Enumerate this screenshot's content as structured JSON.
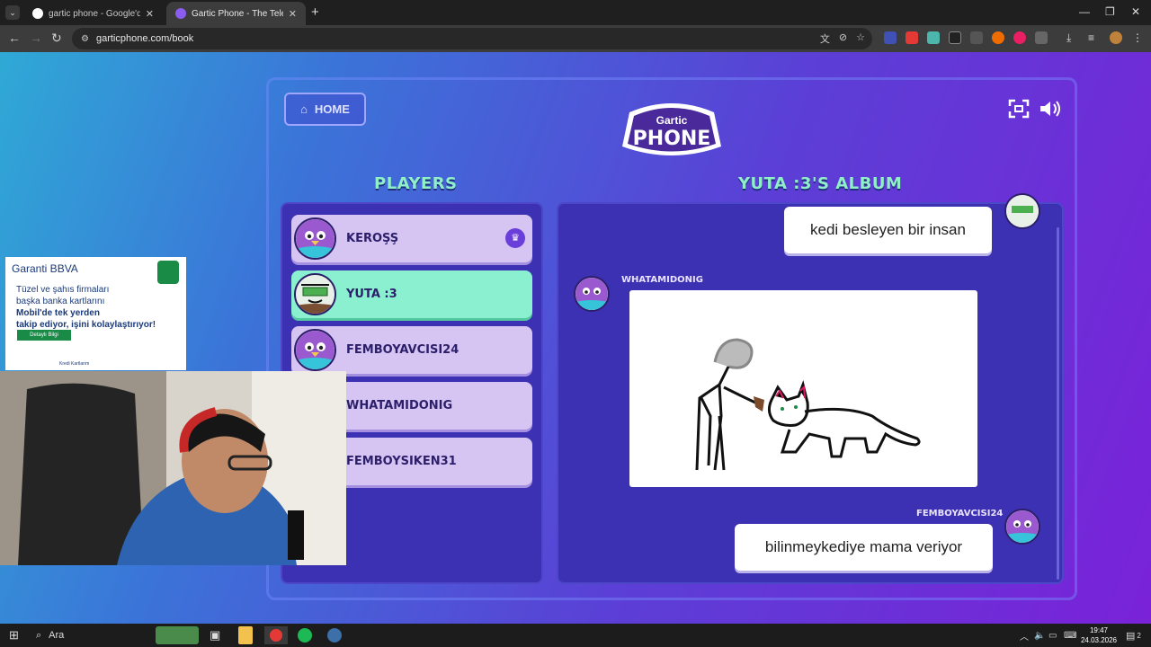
{
  "browser": {
    "tabs": [
      {
        "title": "gartic phone - Google'da Ara",
        "favicon_color": "#ffffff",
        "active": false
      },
      {
        "title": "Gartic Phone - The Telephone G",
        "favicon_color": "#8a5cf0",
        "active": true
      }
    ],
    "url": "garticphone.com/book"
  },
  "game": {
    "home_label": "HOME",
    "logo_top": "Gartic",
    "logo_bottom": "PHONE",
    "players_title": "PLAYERS",
    "album_title": "YUTA :3'S ALBUM",
    "players": [
      {
        "name": "KEROŞŞ",
        "host": true,
        "selected": false
      },
      {
        "name": "YUTA :3",
        "host": false,
        "selected": true
      },
      {
        "name": "FEMBOYAVCISI24",
        "host": false,
        "selected": false
      },
      {
        "name": "WHATAMIDONIG",
        "host": false,
        "selected": false
      },
      {
        "name": "FEMBOYSIKEN31",
        "host": false,
        "selected": false
      }
    ],
    "album": {
      "first_phrase": "kedi besleyen bir insan",
      "drawing_author": "WHATAMIDONIG",
      "guess_author": "FEMBOYAVCISI24",
      "guess_phrase": "bilinmeykediye mama veriyor"
    }
  },
  "ad": {
    "brand": "Garanti BBVA",
    "body_line1": "Tüzel ve şahıs firmaları",
    "body_line2": "başka banka kartlarını",
    "body_line3": "Mobil'de tek yerden",
    "body_line4": "takip ediyor, işini kolaylaştırıyor!",
    "cta": "Detaylı Bilgi",
    "card_text": "Kredi Kartlarım"
  },
  "taskbar": {
    "search_label": "Ara",
    "time": "19:47",
    "date": "24.03.2026",
    "notification_count": "2"
  }
}
